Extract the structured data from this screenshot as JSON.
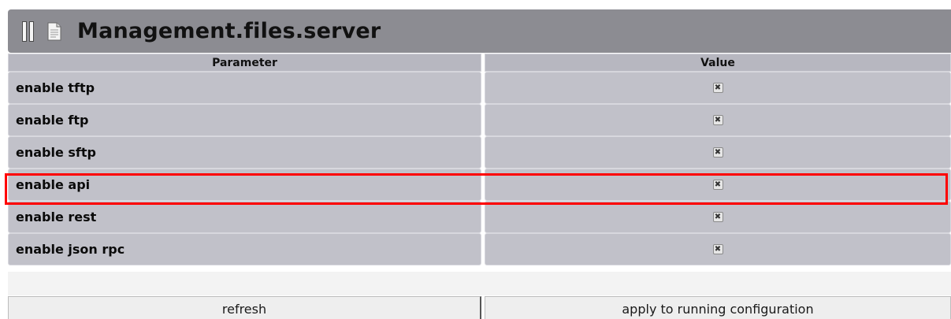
{
  "window": {
    "title": "Management.files.server",
    "icons": [
      "pane-toggle-icon",
      "document-icon"
    ]
  },
  "table": {
    "columns": [
      "Parameter",
      "Value"
    ],
    "rows": [
      {
        "parameter": "enable tftp",
        "value": "✖",
        "checked": true
      },
      {
        "parameter": "enable ftp",
        "value": "✖",
        "checked": true
      },
      {
        "parameter": "enable sftp",
        "value": "✖",
        "checked": true
      },
      {
        "parameter": "enable api",
        "value": "✖",
        "checked": true,
        "highlighted": true
      },
      {
        "parameter": "enable rest",
        "value": "✖",
        "checked": true
      },
      {
        "parameter": "enable json rpc",
        "value": "✖",
        "checked": true
      }
    ]
  },
  "buttons": {
    "refresh": "refresh",
    "apply": "apply to running configuration"
  },
  "colors": {
    "title_bar": "#8c8c92",
    "header_bg": "#b7b7c0",
    "row_bg": "#c1c1c9",
    "highlight": "#ff0000"
  }
}
